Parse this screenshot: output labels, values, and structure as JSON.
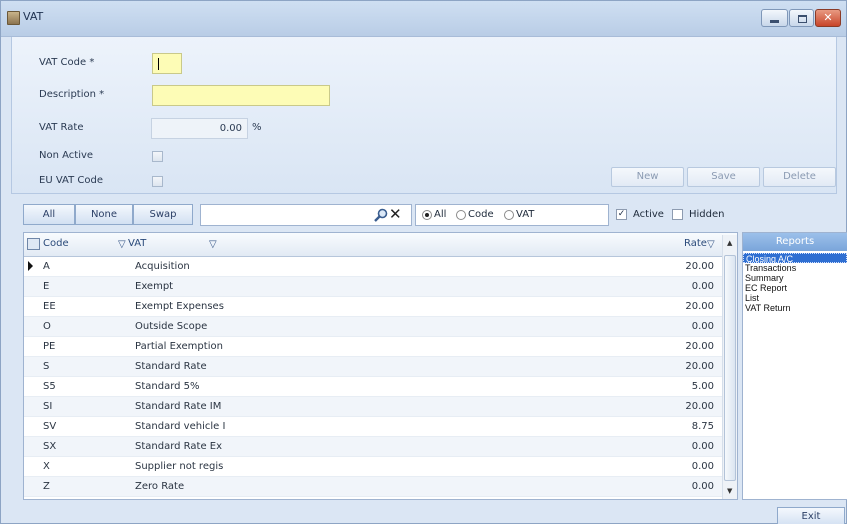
{
  "window": {
    "title": "VAT"
  },
  "form": {
    "vat_code": {
      "label": "VAT Code *",
      "value": ""
    },
    "description": {
      "label": "Description *",
      "value": ""
    },
    "vat_rate": {
      "label": "VAT Rate",
      "value": "0.00",
      "unit": "%"
    },
    "non_active": {
      "label": "Non Active",
      "checked": false
    },
    "eu_vat_code": {
      "label": "EU VAT Code",
      "checked": false
    },
    "buttons": {
      "new": "New",
      "save": "Save",
      "delete": "Delete"
    }
  },
  "toolbar": {
    "all": "All",
    "none": "None",
    "swap": "Swap",
    "search_value": "",
    "filter": {
      "all": "All",
      "code": "Code",
      "vat": "VAT",
      "selected": "All"
    },
    "active": {
      "label": "Active",
      "checked": true
    },
    "hidden": {
      "label": "Hidden",
      "checked": false
    }
  },
  "grid": {
    "headers": {
      "code": "Code",
      "vat": "VAT",
      "rate": "Rate"
    },
    "rows": [
      {
        "code": "A",
        "vat": "Acquisition",
        "rate": "20.00",
        "current": true
      },
      {
        "code": "E",
        "vat": "Exempt",
        "rate": "0.00"
      },
      {
        "code": "EE",
        "vat": "Exempt Expenses",
        "rate": "20.00"
      },
      {
        "code": "O",
        "vat": "Outside Scope",
        "rate": "0.00"
      },
      {
        "code": "PE",
        "vat": "Partial Exemption",
        "rate": "20.00"
      },
      {
        "code": "S",
        "vat": "Standard Rate",
        "rate": "20.00"
      },
      {
        "code": "S5",
        "vat": "Standard 5%",
        "rate": "5.00"
      },
      {
        "code": "SI",
        "vat": "Standard Rate IM",
        "rate": "20.00"
      },
      {
        "code": "SV",
        "vat": "Standard vehicle I",
        "rate": "8.75"
      },
      {
        "code": "SX",
        "vat": "Standard Rate Ex",
        "rate": "0.00"
      },
      {
        "code": "X",
        "vat": "Supplier not regis",
        "rate": "0.00"
      },
      {
        "code": "Z",
        "vat": "Zero Rate",
        "rate": "0.00"
      }
    ]
  },
  "reports": {
    "title": "Reports",
    "items": [
      "Closing A/C",
      "Transactions",
      "Summary",
      "EC Report",
      "List",
      "VAT Return"
    ],
    "selected": "Closing A/C"
  },
  "footer": {
    "exit": "Exit"
  },
  "icons": {
    "app": "vat-app-icon",
    "search": "search-icon",
    "clear": "clear-x-icon",
    "filter": "funnel-icon"
  }
}
